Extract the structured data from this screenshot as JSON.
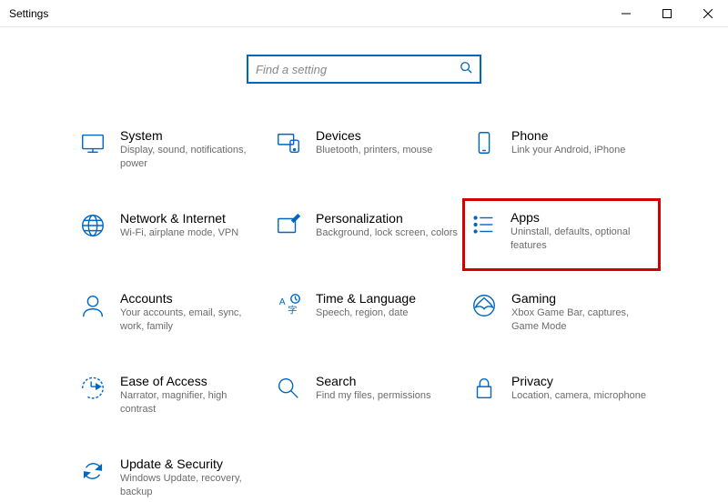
{
  "window": {
    "title": "Settings"
  },
  "search": {
    "placeholder": "Find a setting"
  },
  "tiles": {
    "system": {
      "title": "System",
      "desc": "Display, sound, notifications, power"
    },
    "devices": {
      "title": "Devices",
      "desc": "Bluetooth, printers, mouse"
    },
    "phone": {
      "title": "Phone",
      "desc": "Link your Android, iPhone"
    },
    "network": {
      "title": "Network & Internet",
      "desc": "Wi-Fi, airplane mode, VPN"
    },
    "personalization": {
      "title": "Personalization",
      "desc": "Background, lock screen, colors"
    },
    "apps": {
      "title": "Apps",
      "desc": "Uninstall, defaults, optional features"
    },
    "accounts": {
      "title": "Accounts",
      "desc": "Your accounts, email, sync, work, family"
    },
    "time": {
      "title": "Time & Language",
      "desc": "Speech, region, date"
    },
    "gaming": {
      "title": "Gaming",
      "desc": "Xbox Game Bar, captures, Game Mode"
    },
    "ease": {
      "title": "Ease of Access",
      "desc": "Narrator, magnifier, high contrast"
    },
    "search": {
      "title": "Search",
      "desc": "Find my files, permissions"
    },
    "privacy": {
      "title": "Privacy",
      "desc": "Location, camera, microphone"
    },
    "update": {
      "title": "Update & Security",
      "desc": "Windows Update, recovery, backup"
    }
  }
}
